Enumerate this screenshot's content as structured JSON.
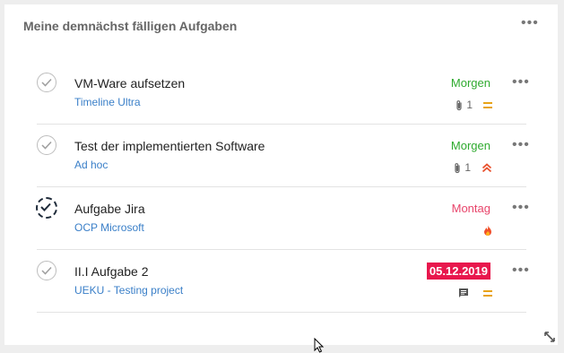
{
  "widget": {
    "title": "Meine demnächst fälligen Aufgaben",
    "menu_icon": "more-horizontal-icon",
    "resize_icon": "resize-diagonal-icon"
  },
  "colors": {
    "due_soon": "#2eaa2e",
    "due_later": "#e8456b",
    "overdue_badge": "#e8174d",
    "project_link": "#3a7fc8",
    "priority_normal": "#e8a317",
    "priority_high": "#e8512e"
  },
  "tasks": [
    {
      "name": "VM-Ware aufsetzen",
      "project": "Timeline Ultra",
      "due": "Morgen",
      "attachments": "1",
      "priority_icon": "priority-normal-icon",
      "status_icon": "check-circle-icon"
    },
    {
      "name": "Test der implementierten Software",
      "project": "Ad hoc",
      "due": "Morgen",
      "attachments": "1",
      "priority_icon": "priority-high-icon",
      "status_icon": "check-circle-icon"
    },
    {
      "name": "Aufgabe Jira",
      "project": "OCP Microsoft",
      "due": "Montag",
      "priority_icon": "fire-icon",
      "status_icon": "in-progress-check-icon"
    },
    {
      "name": "II.I Aufgabe 2",
      "project": "UEKU - Testing project",
      "due": "05.12.2019",
      "comment_icon": "comment-icon",
      "priority_icon": "priority-normal-icon",
      "status_icon": "check-circle-icon"
    }
  ]
}
